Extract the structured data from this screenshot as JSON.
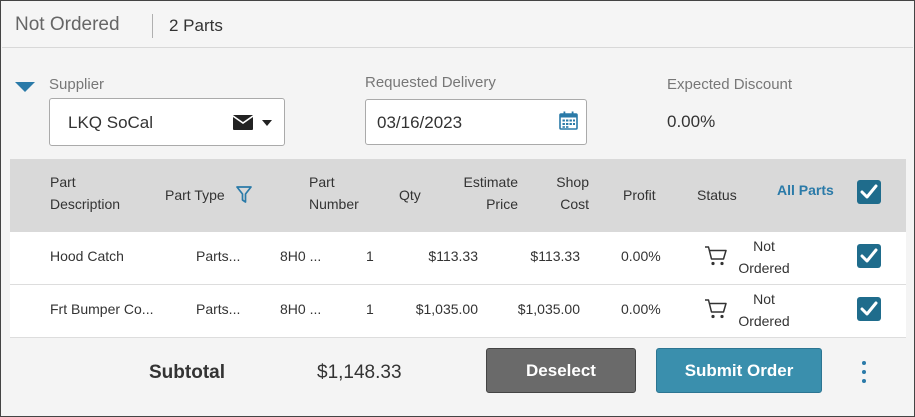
{
  "header": {
    "title": "Not Ordered",
    "count": "2 Parts"
  },
  "form": {
    "supplier_label": "Supplier",
    "supplier_value": "LKQ SoCal",
    "delivery_label": "Requested Delivery",
    "delivery_value": "03/16/2023",
    "discount_label": "Expected Discount",
    "discount_value": "0.00%"
  },
  "table": {
    "columns": {
      "part_description": [
        "Part",
        "Description"
      ],
      "part_type": "Part Type",
      "part_number": [
        "Part",
        "Number"
      ],
      "qty": "Qty",
      "estimate_price": [
        "Estimate",
        "Price"
      ],
      "shop_cost": [
        "Shop",
        "Cost"
      ],
      "profit": "Profit",
      "status": "Status",
      "all_parts": "All Parts"
    },
    "rows": [
      {
        "description": "Hood Catch",
        "type": "Parts...",
        "number": "8H0 ...",
        "qty": "1",
        "estimate": "$113.33",
        "cost": "$113.33",
        "profit": "0.00%",
        "status_line1": "Not",
        "status_line2": "Ordered",
        "checked": true
      },
      {
        "description": "Frt Bumper Co...",
        "type": "Parts...",
        "number": "8H0 ...",
        "qty": "1",
        "estimate": "$1,035.00",
        "cost": "$1,035.00",
        "profit": "0.00%",
        "status_line1": "Not",
        "status_line2": "Ordered",
        "checked": true
      }
    ]
  },
  "footer": {
    "subtotal_label": "Subtotal",
    "subtotal_value": "$1,148.33",
    "deselect_label": "Deselect",
    "submit_label": "Submit Order"
  },
  "icons": {
    "collapse": "triangle-down-icon",
    "supplier_contact": "envelope-icon",
    "supplier_dropdown": "caret-down-icon",
    "date": "calendar-icon",
    "filter": "filter-icon",
    "cart": "cart-icon",
    "more": "kebab-menu-icon"
  },
  "colors": {
    "accent": "#2a7aa8",
    "checkbox": "#1f6c8c",
    "submit": "#3a8fad",
    "deselect": "#6a6a6a",
    "header_bg": "#d9d9d9"
  }
}
